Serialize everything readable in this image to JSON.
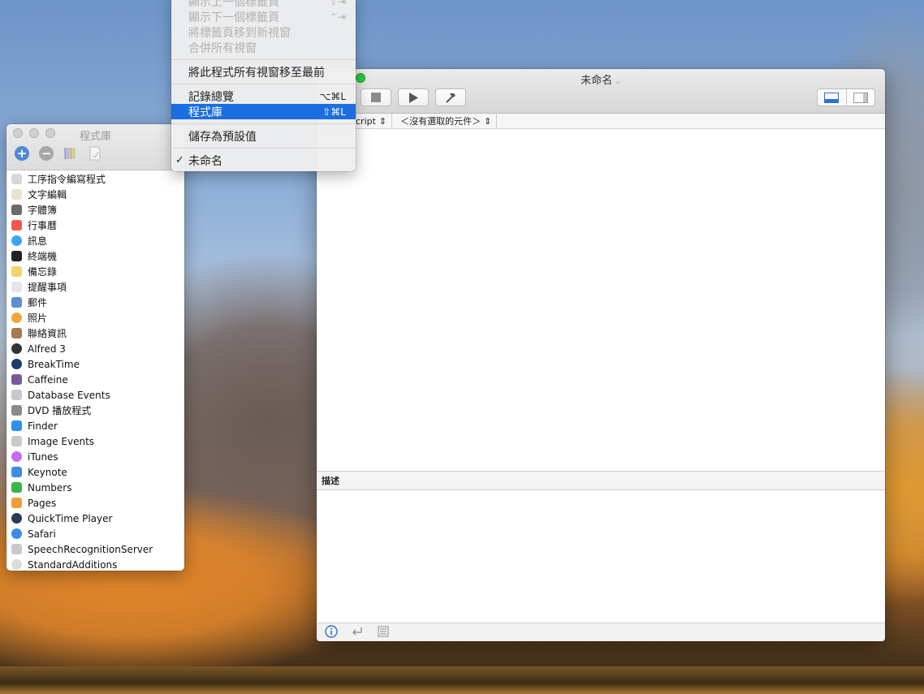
{
  "menu": {
    "items": [
      {
        "label": "顯示上一個標籤頁",
        "shortcut": "⌃⇧⇥",
        "disabled": true
      },
      {
        "label": "顯示下一個標籤頁",
        "shortcut": "⌃⇥",
        "disabled": true
      },
      {
        "label": "將標籤頁移到新視窗",
        "disabled": true
      },
      {
        "label": "合併所有視窗",
        "disabled": true
      },
      {
        "label": "將此程式所有視窗移至最前"
      },
      {
        "label": "記錄總覽",
        "shortcut": "⌥⌘L"
      },
      {
        "label": "程式庫",
        "shortcut": "⇧⌘L",
        "selected": true
      },
      {
        "label": "儲存為預設值"
      },
      {
        "label": "未命名",
        "checked": true,
        "check_mark": "✓"
      }
    ]
  },
  "library": {
    "title": "程式庫",
    "toolbar": {
      "add": "+",
      "remove": "−"
    },
    "items": [
      {
        "label": "工序指令編寫程式",
        "icon": "script-editor-icon",
        "color": "#d8d8d8"
      },
      {
        "label": "文字編輯",
        "icon": "textedit-icon",
        "color": "#e9e2cf"
      },
      {
        "label": "字體簿",
        "icon": "font-book-icon",
        "color": "#6b6b6b"
      },
      {
        "label": "行事曆",
        "icon": "calendar-icon",
        "color": "#f15a4a"
      },
      {
        "label": "訊息",
        "icon": "messages-icon",
        "color": "#3aa4f5"
      },
      {
        "label": "終端機",
        "icon": "terminal-icon",
        "color": "#222222"
      },
      {
        "label": "備忘錄",
        "icon": "notes-icon",
        "color": "#f3d36b"
      },
      {
        "label": "提醒事項",
        "icon": "reminders-icon",
        "color": "#e6e6e6"
      },
      {
        "label": "郵件",
        "icon": "mail-icon",
        "color": "#5b8fd4"
      },
      {
        "label": "照片",
        "icon": "photos-icon",
        "color": "#f0a63a"
      },
      {
        "label": "聯絡資訊",
        "icon": "contacts-icon",
        "color": "#a57b4b"
      },
      {
        "label": "Alfred 3",
        "icon": "alfred-icon",
        "color": "#333333"
      },
      {
        "label": "BreakTime",
        "icon": "breaktime-icon",
        "color": "#1d3a6b"
      },
      {
        "label": "Caffeine",
        "icon": "caffeine-icon",
        "color": "#7a5a9a"
      },
      {
        "label": "Database Events",
        "icon": "database-events-icon",
        "color": "#c9c9c9"
      },
      {
        "label": "DVD 播放程式",
        "icon": "dvd-player-icon",
        "color": "#8a8a8a"
      },
      {
        "label": "Finder",
        "icon": "finder-icon",
        "color": "#2f8ff0"
      },
      {
        "label": "Image Events",
        "icon": "image-events-icon",
        "color": "#c9c9c9"
      },
      {
        "label": "iTunes",
        "icon": "itunes-icon",
        "color": "#c66cf0"
      },
      {
        "label": "Keynote",
        "icon": "keynote-icon",
        "color": "#3d8de0"
      },
      {
        "label": "Numbers",
        "icon": "numbers-icon",
        "color": "#3bb54a"
      },
      {
        "label": "Pages",
        "icon": "pages-icon",
        "color": "#f29d32"
      },
      {
        "label": "QuickTime Player",
        "icon": "quicktime-icon",
        "color": "#2a3b55"
      },
      {
        "label": "Safari",
        "icon": "safari-icon",
        "color": "#3a8de6"
      },
      {
        "label": "SpeechRecognitionServer",
        "icon": "speech-recognition-icon",
        "color": "#c9c9c9"
      },
      {
        "label": "StandardAdditions",
        "icon": "standard-additions-icon",
        "color": "#dcdcdc"
      }
    ]
  },
  "editor": {
    "title": "未命名",
    "language": "cript",
    "element_selector": "＜沒有選取的元件＞",
    "description_label": "描述"
  },
  "colors": {
    "selection": "#1b6ee0",
    "green_button": "#28c840"
  }
}
